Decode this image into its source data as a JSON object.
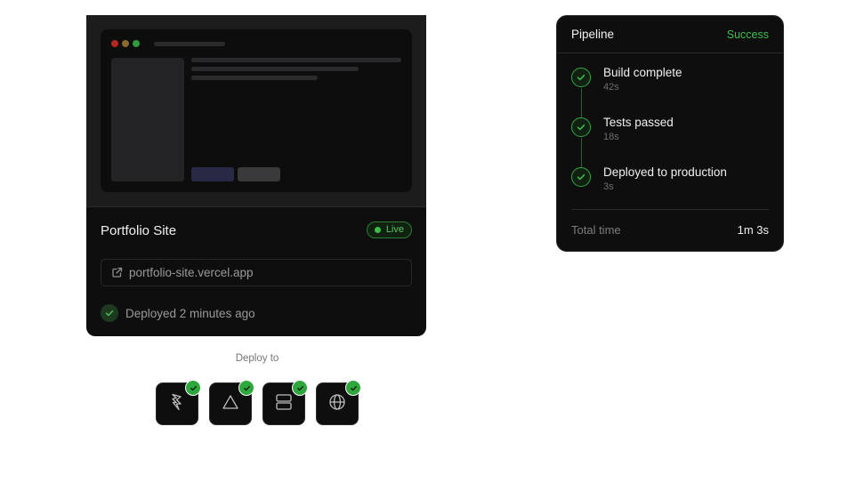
{
  "project": {
    "name": "Portfolio Site",
    "status_badge": "Live",
    "url": "portfolio-site.vercel.app",
    "deploy_status": "Deployed 2 minutes ago"
  },
  "deploy_to": {
    "label": "Deploy to",
    "targets": [
      {
        "icon": "lightning-icon",
        "checked": true
      },
      {
        "icon": "triangle-icon",
        "checked": true
      },
      {
        "icon": "server-icon",
        "checked": true
      },
      {
        "icon": "globe-icon",
        "checked": true
      }
    ]
  },
  "pipeline": {
    "title": "Pipeline",
    "status": "Success",
    "steps": [
      {
        "title": "Build complete",
        "duration": "42s"
      },
      {
        "title": "Tests passed",
        "duration": "18s"
      },
      {
        "title": "Deployed to production",
        "duration": "3s"
      }
    ],
    "total_label": "Total time",
    "total_value": "1m 3s"
  },
  "colors": {
    "success": "#3fbf4d",
    "card_background": "#0e0e0f"
  }
}
